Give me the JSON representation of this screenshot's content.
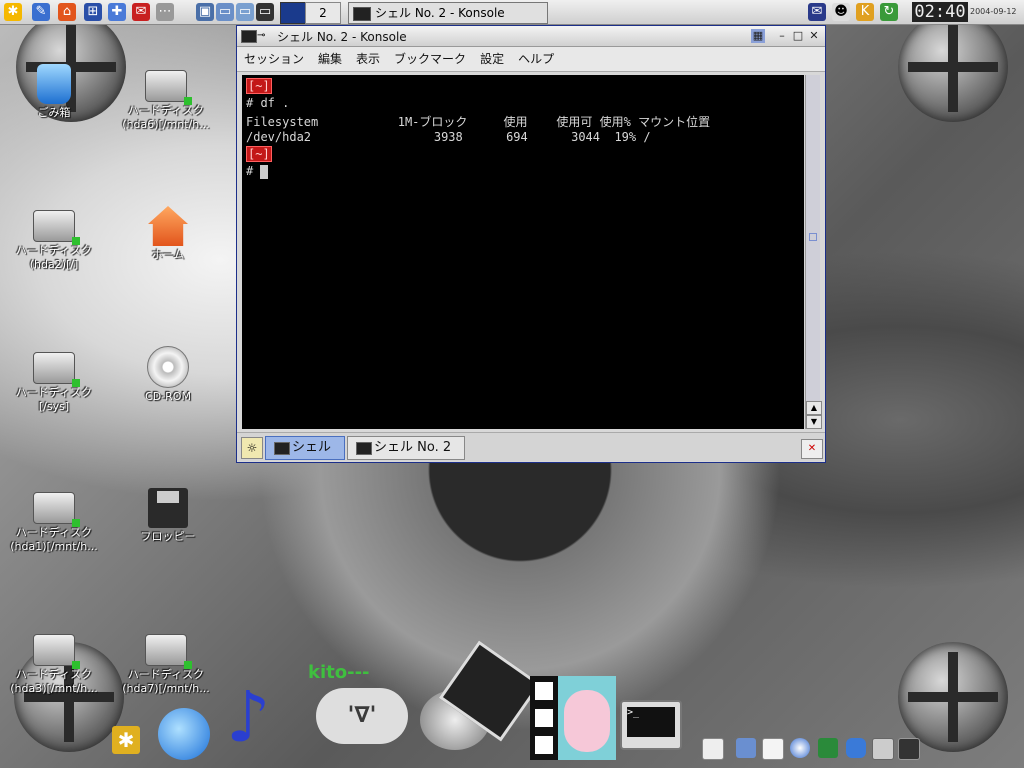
{
  "top_panel": {
    "desktop_number": "2",
    "task_button": "シェル No. 2 - Konsole",
    "clock": "02:40",
    "date": "2004-09-12"
  },
  "desktop_icons": [
    {
      "label": "ごみ箱",
      "sub": ""
    },
    {
      "label": "ハードディスク",
      "sub": "(hda6)[/mnt/h..."
    },
    {
      "label": "ハードディスク",
      "sub": "(hda2)[/]"
    },
    {
      "label": "ホーム",
      "sub": ""
    },
    {
      "label": "ハードディスク",
      "sub": "[/sys]"
    },
    {
      "label": "CD-ROM",
      "sub": ""
    },
    {
      "label": "ハードディスク",
      "sub": "(hda1)[/mnt/h..."
    },
    {
      "label": "フロッピー",
      "sub": ""
    },
    {
      "label": "ハードディスク",
      "sub": "(hda3)[/mnt/h..."
    },
    {
      "label": "ハードディスク",
      "sub": "(hda7)[/mnt/h..."
    }
  ],
  "window": {
    "title": "シェル No. 2 - Konsole",
    "menu": [
      "セッション",
      "編集",
      "表示",
      "ブックマーク",
      "設定",
      "ヘルプ"
    ],
    "terminal": {
      "prompt": "[~]",
      "line1": "# df .",
      "header": "Filesystem           1M-ブロック     使用    使用可 使用% マウント位置",
      "row": "/dev/hda2                 3938      694      3044  19% /",
      "prompt2": "[~]",
      "line_last": "# "
    },
    "tabs": [
      "シェル",
      "シェル No. 2"
    ]
  },
  "dock": {
    "kito_text": "kito---",
    "kito_face": "'∇'",
    "monitor_text": ">_"
  },
  "colors": {
    "accent": "#1c2f8a",
    "prompt_red": "#c31818",
    "active_tab": "#9db7e8"
  }
}
